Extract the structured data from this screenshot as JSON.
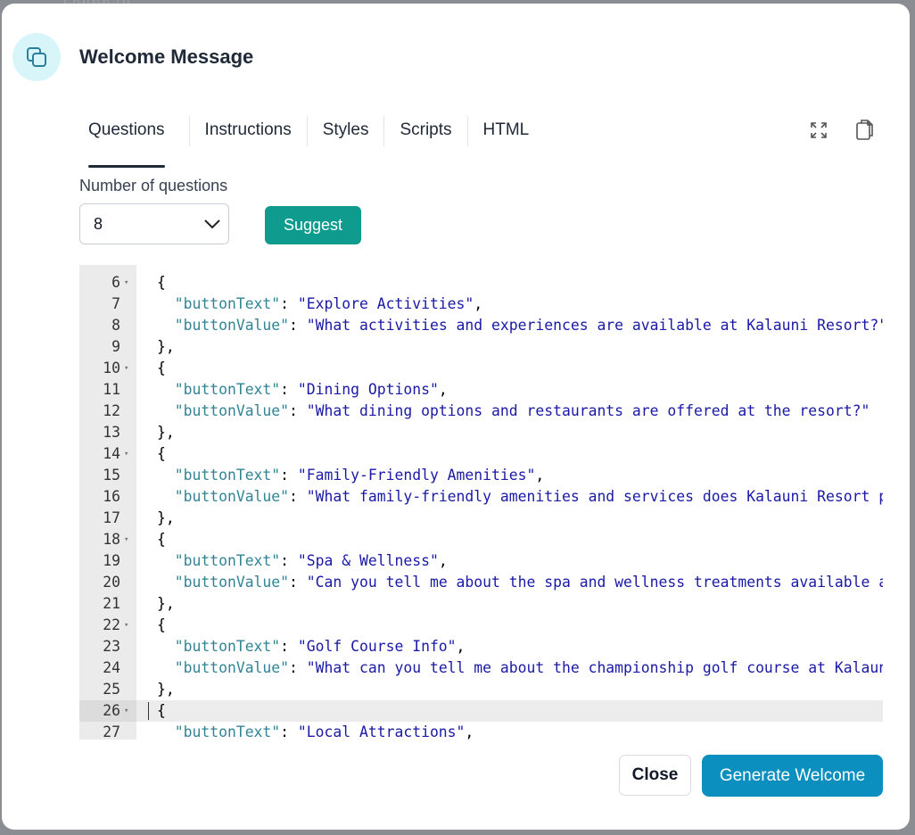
{
  "background": {
    "partial_text": "Ligagent"
  },
  "modal": {
    "title": "Welcome Message",
    "tabs": [
      "Questions",
      "Instructions",
      "Styles",
      "Scripts",
      "HTML"
    ],
    "active_tab": "Questions",
    "toolbar_icons": [
      "expand-icon",
      "clipboard-icon"
    ]
  },
  "form": {
    "number_label": "Number of questions",
    "number_value": "8",
    "suggest_label": "Suggest"
  },
  "editor": {
    "lines": [
      {
        "n": "6",
        "fold": true,
        "code": "{"
      },
      {
        "n": "7",
        "fold": false,
        "key": "buttonText",
        "value": "Explore Activities",
        "comma": true
      },
      {
        "n": "8",
        "fold": false,
        "key": "buttonValue",
        "value": "What activities and experiences are available at Kalauni Resort?",
        "comma": false
      },
      {
        "n": "9",
        "fold": false,
        "code": "},"
      },
      {
        "n": "10",
        "fold": true,
        "code": "{"
      },
      {
        "n": "11",
        "fold": false,
        "key": "buttonText",
        "value": "Dining Options",
        "comma": true
      },
      {
        "n": "12",
        "fold": false,
        "key": "buttonValue",
        "value": "What dining options and restaurants are offered at the resort?",
        "comma": false
      },
      {
        "n": "13",
        "fold": false,
        "code": "},"
      },
      {
        "n": "14",
        "fold": true,
        "code": "{"
      },
      {
        "n": "15",
        "fold": false,
        "key": "buttonText",
        "value": "Family-Friendly Amenities",
        "comma": true
      },
      {
        "n": "16",
        "fold": false,
        "key": "buttonValue",
        "value": "What family-friendly amenities and services does Kalauni Resort pro",
        "comma": false,
        "open": true
      },
      {
        "n": "17",
        "fold": false,
        "code": "},"
      },
      {
        "n": "18",
        "fold": true,
        "code": "{"
      },
      {
        "n": "19",
        "fold": false,
        "key": "buttonText",
        "value": "Spa & Wellness",
        "comma": true
      },
      {
        "n": "20",
        "fold": false,
        "key": "buttonValue",
        "value": "Can you tell me about the spa and wellness treatments available at",
        "comma": false,
        "open": true
      },
      {
        "n": "21",
        "fold": false,
        "code": "},"
      },
      {
        "n": "22",
        "fold": true,
        "code": "{"
      },
      {
        "n": "23",
        "fold": false,
        "key": "buttonText",
        "value": "Golf Course Info",
        "comma": true
      },
      {
        "n": "24",
        "fold": false,
        "key": "buttonValue",
        "value": "What can you tell me about the championship golf course at Kalauni",
        "comma": false,
        "open": true
      },
      {
        "n": "25",
        "fold": false,
        "code": "},"
      },
      {
        "n": "26",
        "fold": true,
        "code": "{",
        "active": true
      },
      {
        "n": "27",
        "fold": false,
        "key": "buttonText",
        "value": "Local Attractions",
        "comma": true
      }
    ]
  },
  "footer": {
    "close_label": "Close",
    "generate_label": "Generate Welcome"
  },
  "colors": {
    "accent_teal": "#0f9b8e",
    "primary_blue": "#0a8fbf",
    "icon_bg": "#d8f6fa",
    "json_key": "#318495",
    "json_string": "#1a1aa6"
  }
}
